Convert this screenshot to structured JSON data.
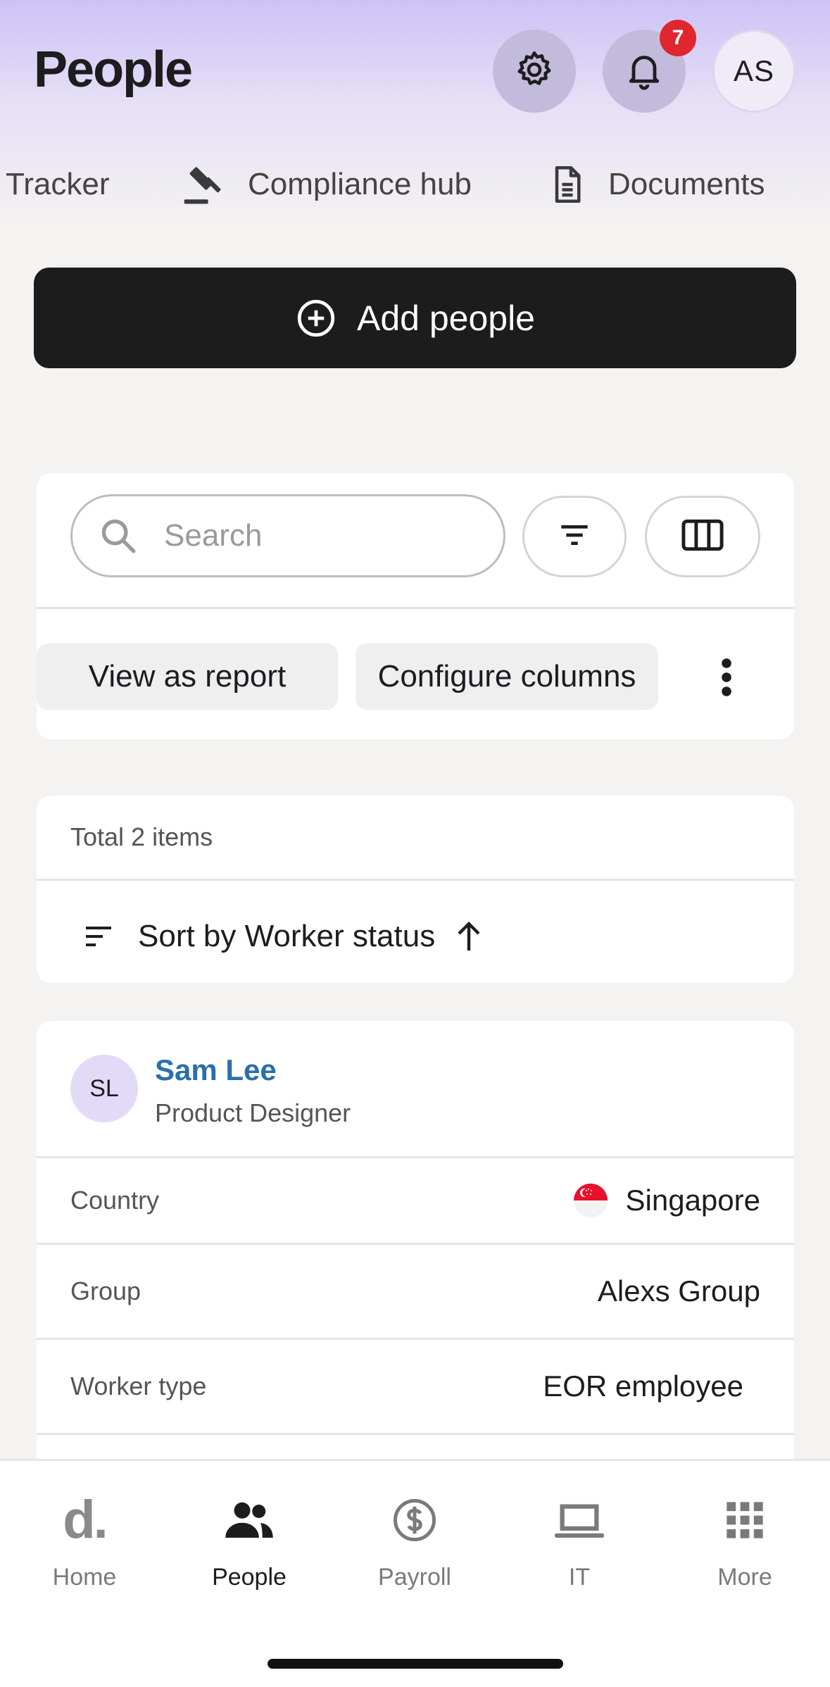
{
  "header": {
    "title": "People",
    "notification_count": "7",
    "avatar_initials": "AS"
  },
  "tabs": [
    {
      "label": "Tracker",
      "icon": "none"
    },
    {
      "label": "Compliance hub",
      "icon": "gavel-icon"
    },
    {
      "label": "Documents",
      "icon": "document-icon"
    }
  ],
  "actions": {
    "add_people_label": "Add people"
  },
  "search": {
    "placeholder": "Search",
    "view_as_report_label": "View as report",
    "configure_columns_label": "Configure columns"
  },
  "list": {
    "total_text": "Total 2 items",
    "sort_label": "Sort by Worker status"
  },
  "person": {
    "initials": "SL",
    "name": "Sam Lee",
    "role": "Product Designer",
    "details": [
      {
        "label": "Country",
        "value": "Singapore"
      },
      {
        "label": "Group",
        "value": "Alexs Group"
      },
      {
        "label": "Worker type",
        "value": "EOR employee"
      }
    ]
  },
  "bottom_nav": [
    {
      "label": "Home",
      "icon": "deel-logo-icon"
    },
    {
      "label": "People",
      "icon": "people-icon",
      "active": true
    },
    {
      "label": "Payroll",
      "icon": "dollar-icon"
    },
    {
      "label": "IT",
      "icon": "laptop-icon"
    },
    {
      "label": "More",
      "icon": "grid-icon"
    }
  ],
  "colors": {
    "accent_link": "#2a6fad",
    "badge": "#e0262e",
    "primary_button": "#1c1c1c"
  }
}
